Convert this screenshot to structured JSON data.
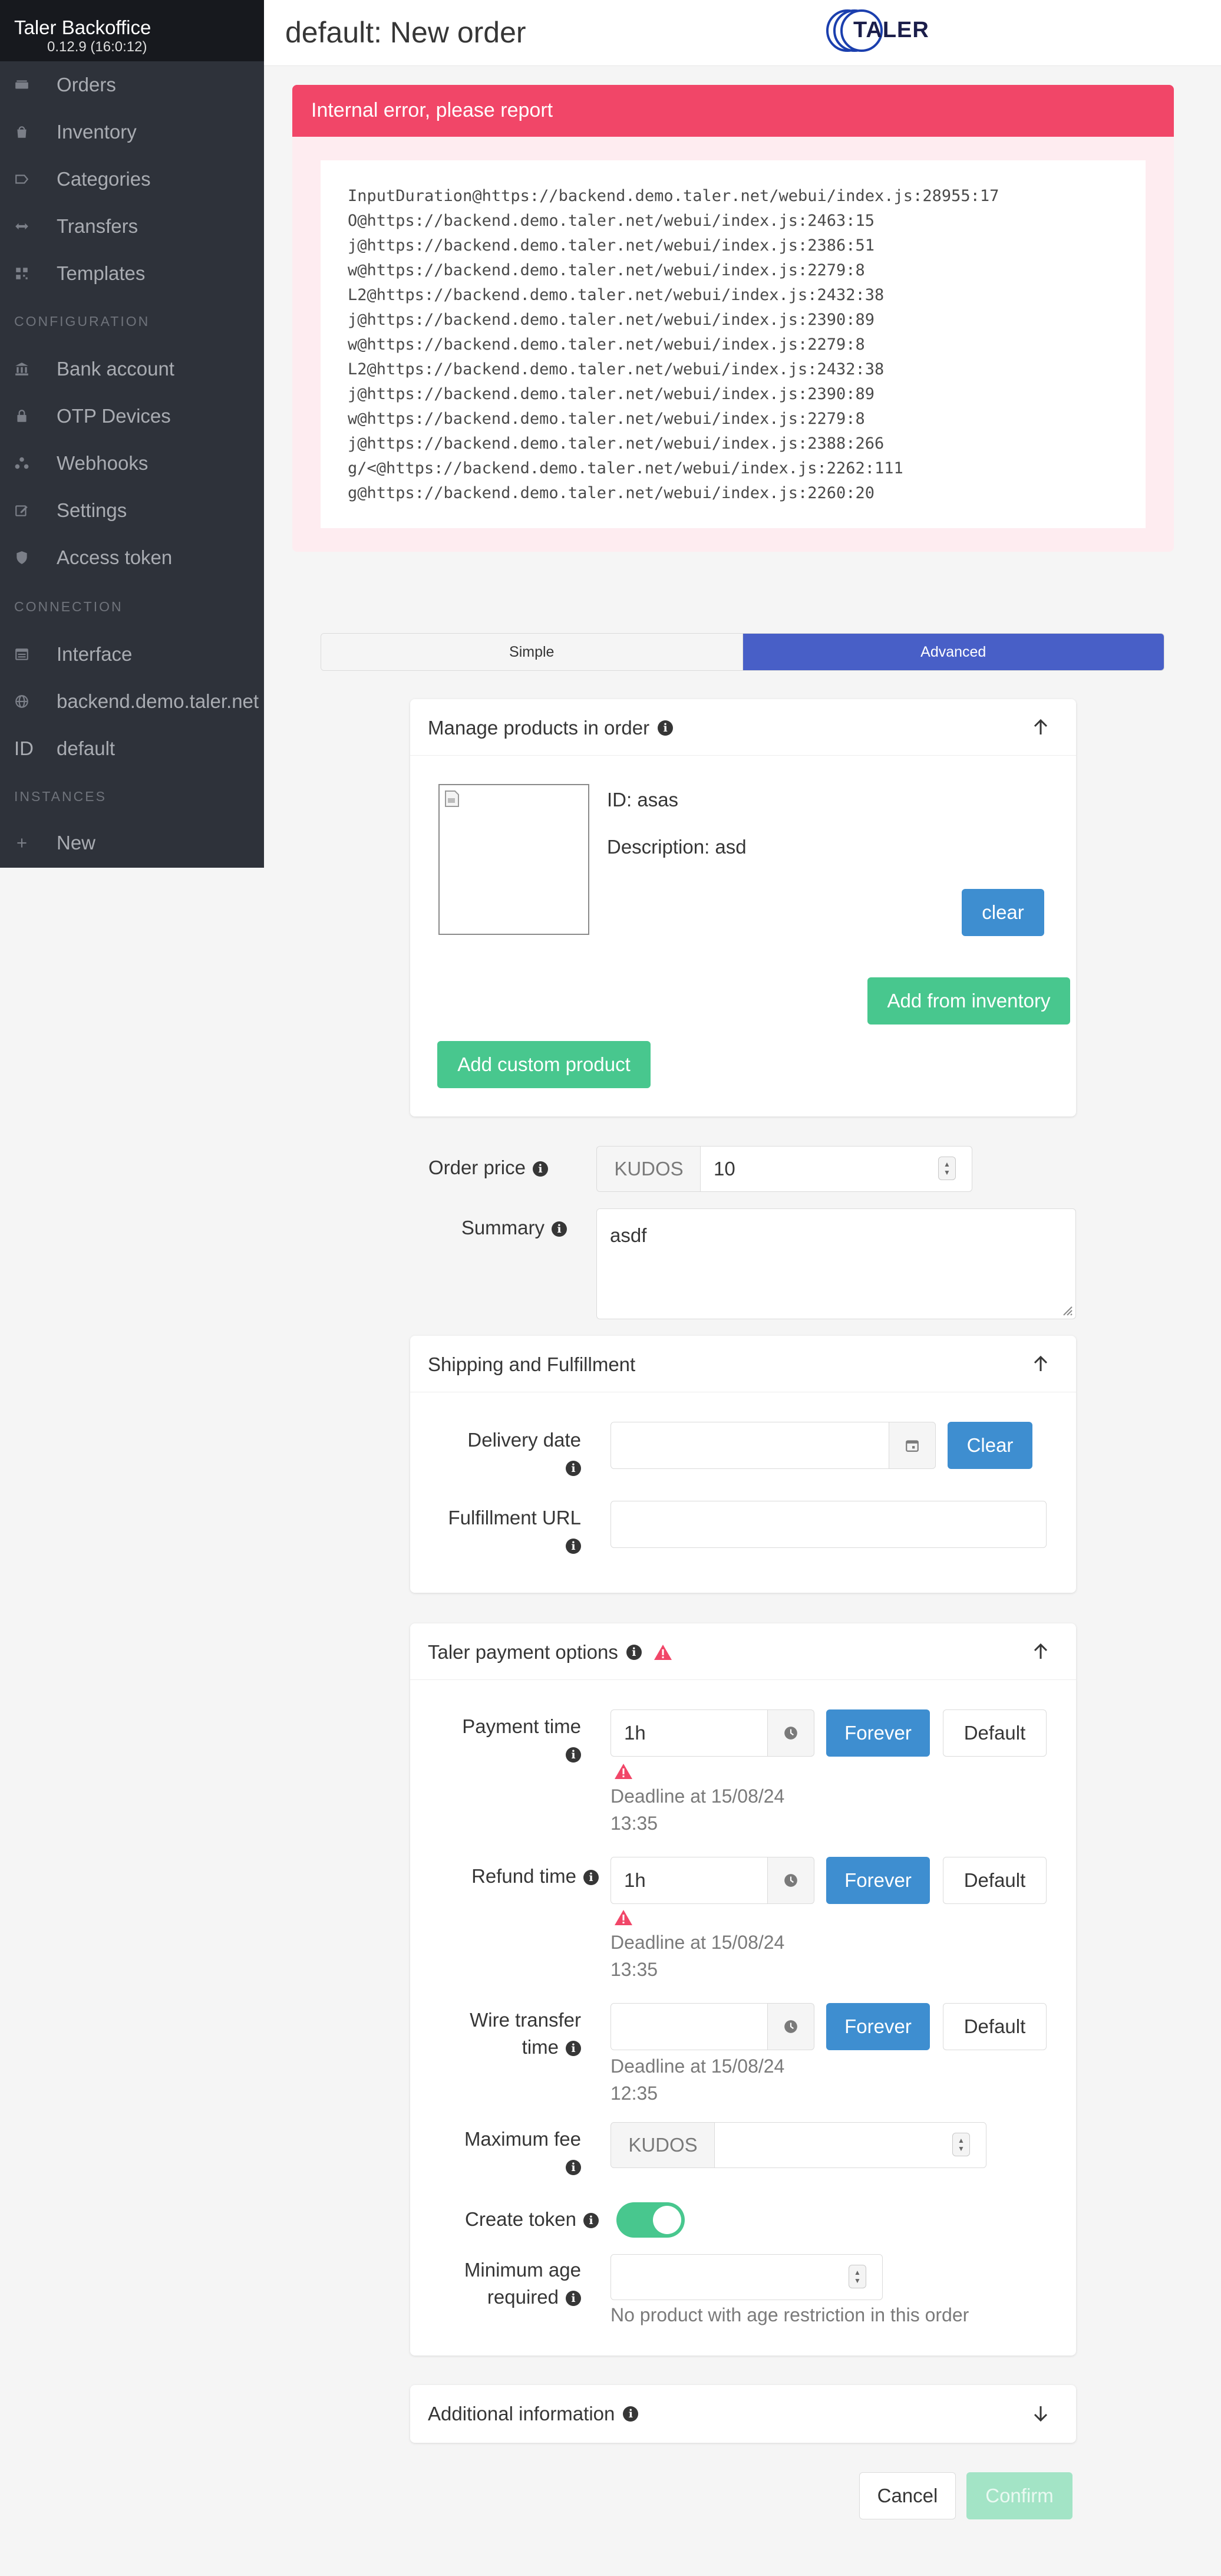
{
  "sidebar": {
    "brand_name": "Taler",
    "brand_suffix": "Backoffice",
    "version": "0.12.9 (16:0:12)",
    "items": [
      {
        "label": "Orders",
        "icon": "cash-icon"
      },
      {
        "label": "Inventory",
        "icon": "shopping-bag-icon"
      },
      {
        "label": "Categories",
        "icon": "label-icon"
      },
      {
        "label": "Transfers",
        "icon": "arrows-left-right-icon"
      },
      {
        "label": "Templates",
        "icon": "qr-code-icon"
      }
    ],
    "section_configuration": "CONFIGURATION",
    "config_items": [
      {
        "label": "Bank account",
        "icon": "bank-icon"
      },
      {
        "label": "OTP Devices",
        "icon": "lock-icon"
      },
      {
        "label": "Webhooks",
        "icon": "webhook-icon"
      },
      {
        "label": "Settings",
        "icon": "edit-icon"
      },
      {
        "label": "Access token",
        "icon": "shield-icon"
      }
    ],
    "section_connection": "CONNECTION",
    "connection_items": [
      {
        "label": "Interface",
        "icon": "table-icon"
      },
      {
        "label": "backend.demo.taler.net",
        "icon": "globe-icon"
      },
      {
        "label": "default",
        "prefix": "ID"
      }
    ],
    "section_instances": "INSTANCES",
    "instance_items": [
      {
        "label": "New",
        "icon": "plus-icon"
      }
    ]
  },
  "header": {
    "title": "default: New order",
    "logo_text": "TALER"
  },
  "error": {
    "title": "Internal error, please report",
    "trace": [
      "InputDuration@https://backend.demo.taler.net/webui/index.js:28955:17",
      "O@https://backend.demo.taler.net/webui/index.js:2463:15",
      "j@https://backend.demo.taler.net/webui/index.js:2386:51",
      "w@https://backend.demo.taler.net/webui/index.js:2279:8",
      "L2@https://backend.demo.taler.net/webui/index.js:2432:38",
      "j@https://backend.demo.taler.net/webui/index.js:2390:89",
      "w@https://backend.demo.taler.net/webui/index.js:2279:8",
      "L2@https://backend.demo.taler.net/webui/index.js:2432:38",
      "j@https://backend.demo.taler.net/webui/index.js:2390:89",
      "w@https://backend.demo.taler.net/webui/index.js:2279:8",
      "j@https://backend.demo.taler.net/webui/index.js:2388:266",
      "g/<@https://backend.demo.taler.net/webui/index.js:2262:111",
      "g@https://backend.demo.taler.net/webui/index.js:2260:20"
    ]
  },
  "tabs": {
    "simple": "Simple",
    "advanced": "Advanced",
    "active": "advanced"
  },
  "products": {
    "title": "Manage products in order",
    "product_id": "ID: asas",
    "product_description": "Description: asd",
    "clear_label": "clear",
    "add_inventory_label": "Add from inventory",
    "add_custom_label": "Add custom product"
  },
  "order": {
    "price_label": "Order price",
    "currency": "KUDOS",
    "price_value": "10",
    "summary_label": "Summary",
    "summary_value": "asdf"
  },
  "shipping": {
    "title": "Shipping and Fulfillment",
    "delivery_label": "Delivery date",
    "delivery_value": "",
    "clear_label": "Clear",
    "fulfillment_label": "Fulfillment URL",
    "fulfillment_value": ""
  },
  "payment": {
    "title": "Taler payment options",
    "payment_time_label": "Payment time",
    "payment_time_value": "1h",
    "payment_deadline": "Deadline at 15/08/24 13:35",
    "refund_time_label": "Refund time",
    "refund_time_value": "1h",
    "refund_deadline": "Deadline at 15/08/24 13:35",
    "wire_time_label": "Wire transfer time",
    "wire_time_value": "",
    "wire_deadline": "Deadline at 15/08/24 12:35",
    "forever_label": "Forever",
    "default_label": "Default",
    "max_fee_label": "Maximum fee",
    "max_fee_currency": "KUDOS",
    "max_fee_value": "",
    "create_token_label": "Create token",
    "create_token_on": true,
    "min_age_label": "Minimum age required",
    "min_age_value": "",
    "min_age_help": "No product with age restriction in this order"
  },
  "additional": {
    "title": "Additional information"
  },
  "footer": {
    "cancel_label": "Cancel",
    "confirm_label": "Confirm"
  },
  "colors": {
    "sidebar_bg": "#2e323a",
    "brand_bg": "#17191e",
    "danger": "#f14668",
    "primary": "#485fc7",
    "info": "#3e8ed0",
    "success": "#48c78e"
  }
}
